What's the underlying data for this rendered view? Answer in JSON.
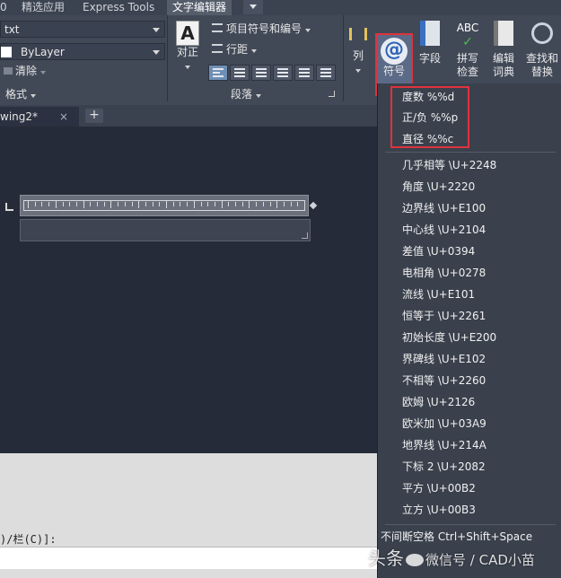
{
  "tabs": {
    "t0": "0",
    "t1": "精选应用",
    "t2": "Express Tools",
    "t3": "文字编辑器"
  },
  "ribbon": {
    "style_value": "txt",
    "color_value": "ByLayer",
    "clear_label": "清除",
    "format_panel": "格式",
    "justify_label": "对正",
    "bullets_label": "项目符号和编号",
    "spacing_label": "行距",
    "paragraph_panel": "段落",
    "columns_label": "列",
    "symbol_label": "符号",
    "field_label": "字段",
    "spell_check_label_1": "拼写",
    "spell_check_label_2": "检查",
    "dictionary_label_1": "编辑",
    "dictionary_label_2": "词典",
    "find_replace_label_1": "查找和",
    "find_replace_label_2": "替换",
    "abc_text": "ABC",
    "at_text": "@",
    "colors": {
      "accent": "#e0323c",
      "ribbon_bg": "#414957"
    }
  },
  "document": {
    "tab_name": "wing2*",
    "close_glyph": "×",
    "new_tab_glyph": "+",
    "command_text": ")/栏(C)]:"
  },
  "menu": {
    "highlighted": [
      {
        "label": "度数  %%d"
      },
      {
        "label": "正/负  %%p"
      },
      {
        "label": "直径  %%c"
      }
    ],
    "items": [
      {
        "label": "几乎相等  \\U+2248"
      },
      {
        "label": "角度  \\U+2220"
      },
      {
        "label": "边界线  \\U+E100"
      },
      {
        "label": "中心线  \\U+2104"
      },
      {
        "label": "差值  \\U+0394"
      },
      {
        "label": "电相角  \\U+0278"
      },
      {
        "label": "流线  \\U+E101"
      },
      {
        "label": "恒等于  \\U+2261"
      },
      {
        "label": "初始长度  \\U+E200"
      },
      {
        "label": "界碑线  \\U+E102"
      },
      {
        "label": "不相等  \\U+2260"
      },
      {
        "label": "欧姆  \\U+2126"
      },
      {
        "label": "欧米加  \\U+03A9"
      },
      {
        "label": "地界线  \\U+214A"
      },
      {
        "label": "下标 2  \\U+2082"
      },
      {
        "label": "平方  \\U+00B2"
      },
      {
        "label": "立方  \\U+00B3"
      }
    ],
    "nbsp_label": "不间断空格 Ctrl+Shift+Space"
  },
  "watermark": {
    "left": "头条",
    "right": "微信号 / CAD小苗"
  }
}
